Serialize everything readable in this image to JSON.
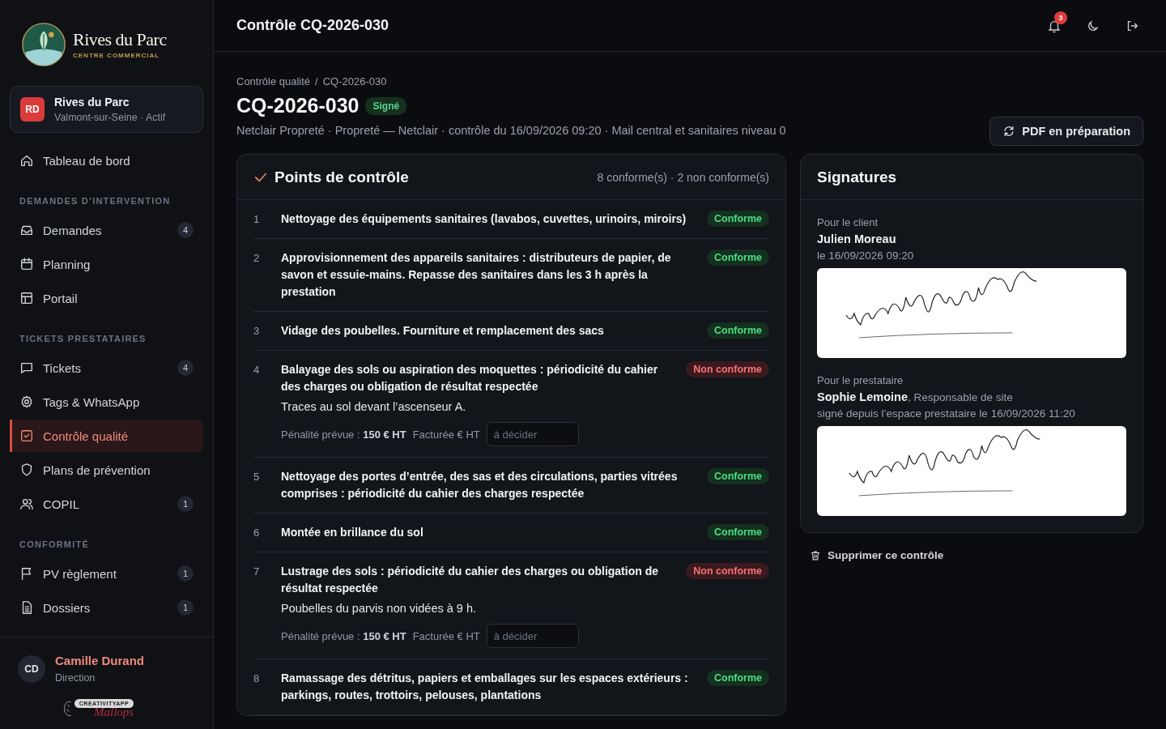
{
  "brand": {
    "name": "Rives du Parc",
    "tagline": "CENTRE COMMERCIAL"
  },
  "site": {
    "initials": "RD",
    "name": "Rives du Parc",
    "subtitle": "Valmont-sur-Seine · Actif"
  },
  "nav": [
    {
      "kind": "item",
      "label": "Tableau de bord",
      "selected": false
    },
    {
      "kind": "section",
      "label": "DEMANDES D’INTERVENTION"
    },
    {
      "kind": "item",
      "label": "Demandes",
      "badge": "4",
      "selected": false
    },
    {
      "kind": "item",
      "label": "Planning",
      "selected": false
    },
    {
      "kind": "item",
      "label": "Portail",
      "selected": false
    },
    {
      "kind": "section",
      "label": "TICKETS PRESTATAIRES"
    },
    {
      "kind": "item",
      "label": "Tickets",
      "badge": "4",
      "selected": false
    },
    {
      "kind": "item",
      "label": "Tags & WhatsApp",
      "selected": false
    },
    {
      "kind": "item",
      "label": "Contrôle qualité",
      "selected": true
    },
    {
      "kind": "item",
      "label": "Plans de prévention",
      "selected": false
    },
    {
      "kind": "item",
      "label": "COPIL",
      "badge": "1",
      "selected": false
    },
    {
      "kind": "section",
      "label": "CONFORMITÉ"
    },
    {
      "kind": "item",
      "label": "PV règlement",
      "badge": "1",
      "selected": false
    },
    {
      "kind": "item",
      "label": "Dossiers",
      "badge": "1",
      "selected": false
    }
  ],
  "user": {
    "initials": "CD",
    "name": "Camille Durand",
    "role": "Direction"
  },
  "footer_logo": {
    "top": "CREATIVITYAPP",
    "script": "Mallops"
  },
  "header": {
    "title": "Contrôle CQ-2026-030",
    "notifications": "3"
  },
  "breadcrumb": {
    "items": [
      "Contrôle qualité",
      "CQ-2026-030"
    ],
    "separator": "/"
  },
  "page": {
    "title": "CQ-2026-030",
    "status": "Signé",
    "subtitle": "Netclair Propreté · Propreté — Netclair · contrôle du 16/09/2026 09:20 · Mail central et sanitaires niveau 0",
    "pdf_button": "PDF en préparation"
  },
  "checklist": {
    "title": "Points de contrôle",
    "summary": "8 conforme(s) · 2 non conforme(s)",
    "items": [
      {
        "number": "1",
        "title": "Nettoyage des équipements sanitaires (lavabos, cuvettes, urinoirs, miroirs)",
        "kind": "ok",
        "status_label": "Conforme"
      },
      {
        "number": "2",
        "title": "Approvisionnement des appareils sanitaires : distributeurs de papier, de savon et essuie-mains. Repasse des sanitaires dans les 3 h après la prestation",
        "kind": "ok",
        "status_label": "Conforme"
      },
      {
        "number": "3",
        "title": "Vidage des poubelles. Fourniture et remplacement des sacs",
        "kind": "ok",
        "status_label": "Conforme"
      },
      {
        "number": "4",
        "title": "Balayage des sols ou aspiration des moquettes : périodicité du cahier des charges ou obligation de résultat respectée",
        "kind": "failed",
        "status_label": "Non conforme",
        "note": "Traces au sol devant l’ascenseur A.",
        "penalty_label": "Pénalité prévue :",
        "penalty": "150 € HT",
        "billed_label": "Facturée € HT",
        "billed_placeholder": "à décider"
      },
      {
        "number": "5",
        "title": "Nettoyage des portes d’entrée, des sas et des circulations, parties vitrées comprises : périodicité du cahier des charges respectée",
        "kind": "ok",
        "status_label": "Conforme"
      },
      {
        "number": "6",
        "title": "Montée en brillance du sol",
        "kind": "ok",
        "status_label": "Conforme"
      },
      {
        "number": "7",
        "title": "Lustrage des sols : périodicité du cahier des charges ou obligation de résultat respectée",
        "kind": "failed",
        "status_label": "Non conforme",
        "note": "Poubelles du parvis non vidées à 9 h.",
        "penalty_label": "Pénalité prévue :",
        "penalty": "150 € HT",
        "billed_label": "Facturée € HT",
        "billed_placeholder": "à décider"
      },
      {
        "number": "8",
        "title": "Ramassage des détritus, papiers et emballages sur les espaces extérieurs : parkings, routes, trottoirs, pelouses, plantations",
        "kind": "ok",
        "status_label": "Conforme"
      }
    ]
  },
  "signatures": {
    "title": "Signatures",
    "entries": [
      {
        "label": "Pour le client",
        "name": "Julien Moreau",
        "date": "le 16/09/2026 09:20"
      },
      {
        "label": "Pour le prestataire",
        "name": "Sophie Lemoine",
        "role": ", Responsable de site",
        "date": "signé depuis l’espace prestataire le 16/09/2026 11:20"
      }
    ]
  },
  "delete_button": "Supprimer ce contrôle"
}
